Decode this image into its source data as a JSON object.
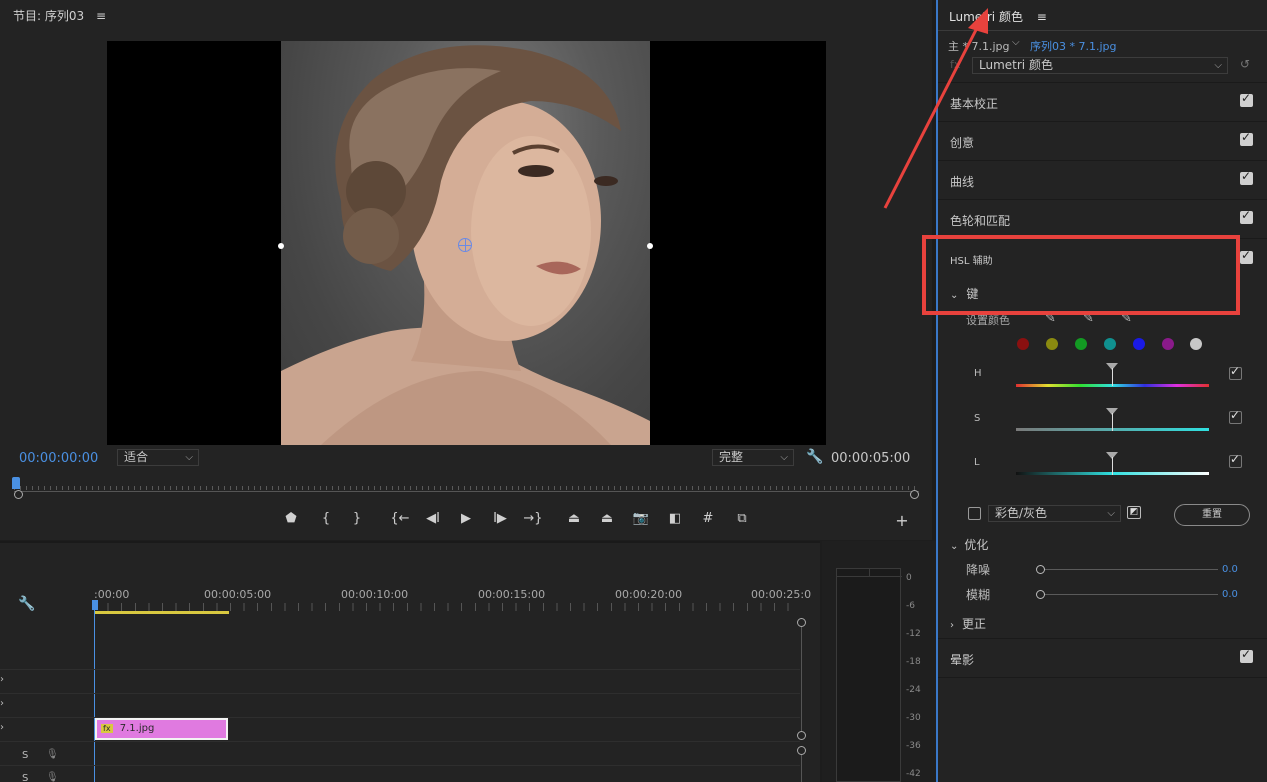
{
  "program_monitor": {
    "title": "节目: 序列03",
    "menu_icon": "≡",
    "timecode_current": "00:00:00:00",
    "zoom_select": "适合",
    "quality_select": "完整",
    "timecode_duration": "00:00:05:00"
  },
  "transport": [
    {
      "name": "marker-icon",
      "glyph": "⬟"
    },
    {
      "name": "mark-in-icon",
      "glyph": "{"
    },
    {
      "name": "mark-out-icon",
      "glyph": "}"
    },
    {
      "name": "go-to-in-icon",
      "glyph": "{←"
    },
    {
      "name": "step-back-icon",
      "glyph": "◀I"
    },
    {
      "name": "play-icon",
      "glyph": "▶"
    },
    {
      "name": "step-forward-icon",
      "glyph": "I▶"
    },
    {
      "name": "go-to-out-icon",
      "glyph": "→}"
    },
    {
      "name": "lift-icon",
      "glyph": "⏏"
    },
    {
      "name": "extract-icon",
      "glyph": "⏏"
    },
    {
      "name": "export-frame-icon",
      "glyph": "📷"
    },
    {
      "name": "compare-icon",
      "glyph": "◧"
    },
    {
      "name": "safe-margins-icon",
      "glyph": "#"
    },
    {
      "name": "vr-icon",
      "glyph": "⧉"
    },
    {
      "name": "add-button-icon",
      "glyph": "+"
    }
  ],
  "timeline": {
    "ruler_labels": [
      ":00:00",
      "00:00:05:00",
      "00:00:10:00",
      "00:00:15:00",
      "00:00:20:00",
      "00:00:25:0"
    ],
    "clip_label": "7.1.jpg",
    "clip_fx": "fx",
    "track_s_label": "S",
    "wrench_icon": "wrench-icon"
  },
  "meter": {
    "labels": [
      "0",
      "-6",
      "-12",
      "-18",
      "-24",
      "-30",
      "-36",
      "-42"
    ]
  },
  "lumetri": {
    "title": "Lumetri 颜色",
    "menu_icon": "≡",
    "master_clip": "主 * 7.1.jpg",
    "sequence_clip": "序列03 * 7.1.jpg",
    "effect_select": "Lumetri 颜色",
    "sections": [
      {
        "label": "基本校正"
      },
      {
        "label": "创意"
      },
      {
        "label": "曲线"
      },
      {
        "label": "色轮和匹配"
      }
    ],
    "hsl_title": "HSL 辅助",
    "key_label": "键",
    "set_color_label": "设置颜色",
    "swatch_colors": [
      "#8a1010",
      "#8a8a10",
      "#139a23",
      "#10908f",
      "#1a1ae6",
      "#8a1a8a",
      "#c8c8c8"
    ],
    "hsl_rows": [
      {
        "label": "H"
      },
      {
        "label": "S"
      },
      {
        "label": "L"
      }
    ],
    "display_mode": "彩色/灰色",
    "reset_button": "重置",
    "refine_label": "优化",
    "denoise_label": "降噪",
    "denoise_value": "0.0",
    "blur_label": "模糊",
    "blur_value": "0.0",
    "correction_label": "更正",
    "vignette_label": "晕影"
  },
  "colors": {
    "accent_blue": "#4a90e2",
    "annotation_red": "#e8423d",
    "clip_pink": "#e07ae0"
  }
}
